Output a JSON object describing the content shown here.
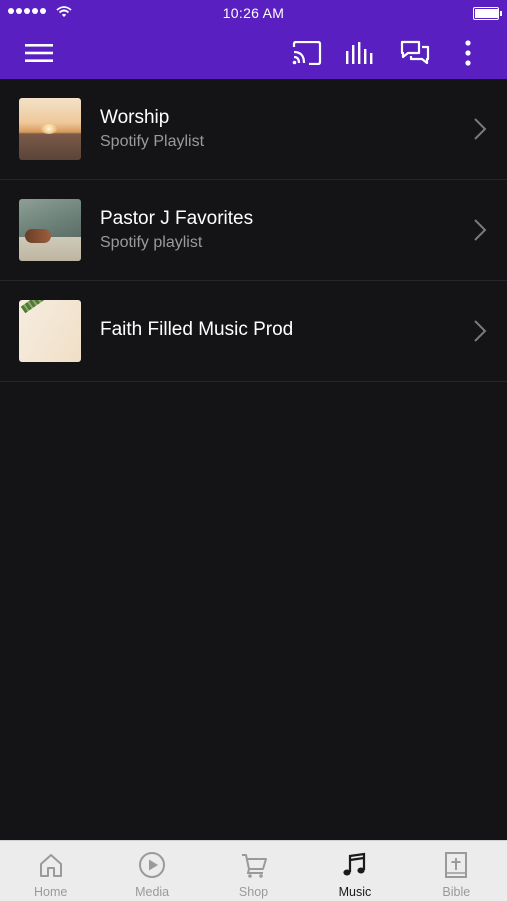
{
  "status_bar": {
    "time": "10:26 AM",
    "battery_level": 0.95
  },
  "app_bar": {
    "icons": [
      "menu-icon",
      "cast-icon",
      "equalizer-icon",
      "chat-icon",
      "more-vertical-icon"
    ]
  },
  "playlists": [
    {
      "title": "Worship",
      "subtitle": "Spotify Playlist"
    },
    {
      "title": "Pastor J Favorites",
      "subtitle": "Spotify playlist"
    },
    {
      "title": "Faith Filled Music Prod",
      "subtitle": ""
    }
  ],
  "tabs": [
    {
      "label": "Home",
      "icon": "home-icon",
      "active": false
    },
    {
      "label": "Media",
      "icon": "play-circle-icon",
      "active": false
    },
    {
      "label": "Shop",
      "icon": "cart-icon",
      "active": false
    },
    {
      "label": "Music",
      "icon": "music-note-icon",
      "active": true
    },
    {
      "label": "Bible",
      "icon": "bible-icon",
      "active": false
    }
  ],
  "colors": {
    "accent": "#5a1fc0",
    "background": "#141416",
    "tabbar": "#ececec"
  }
}
